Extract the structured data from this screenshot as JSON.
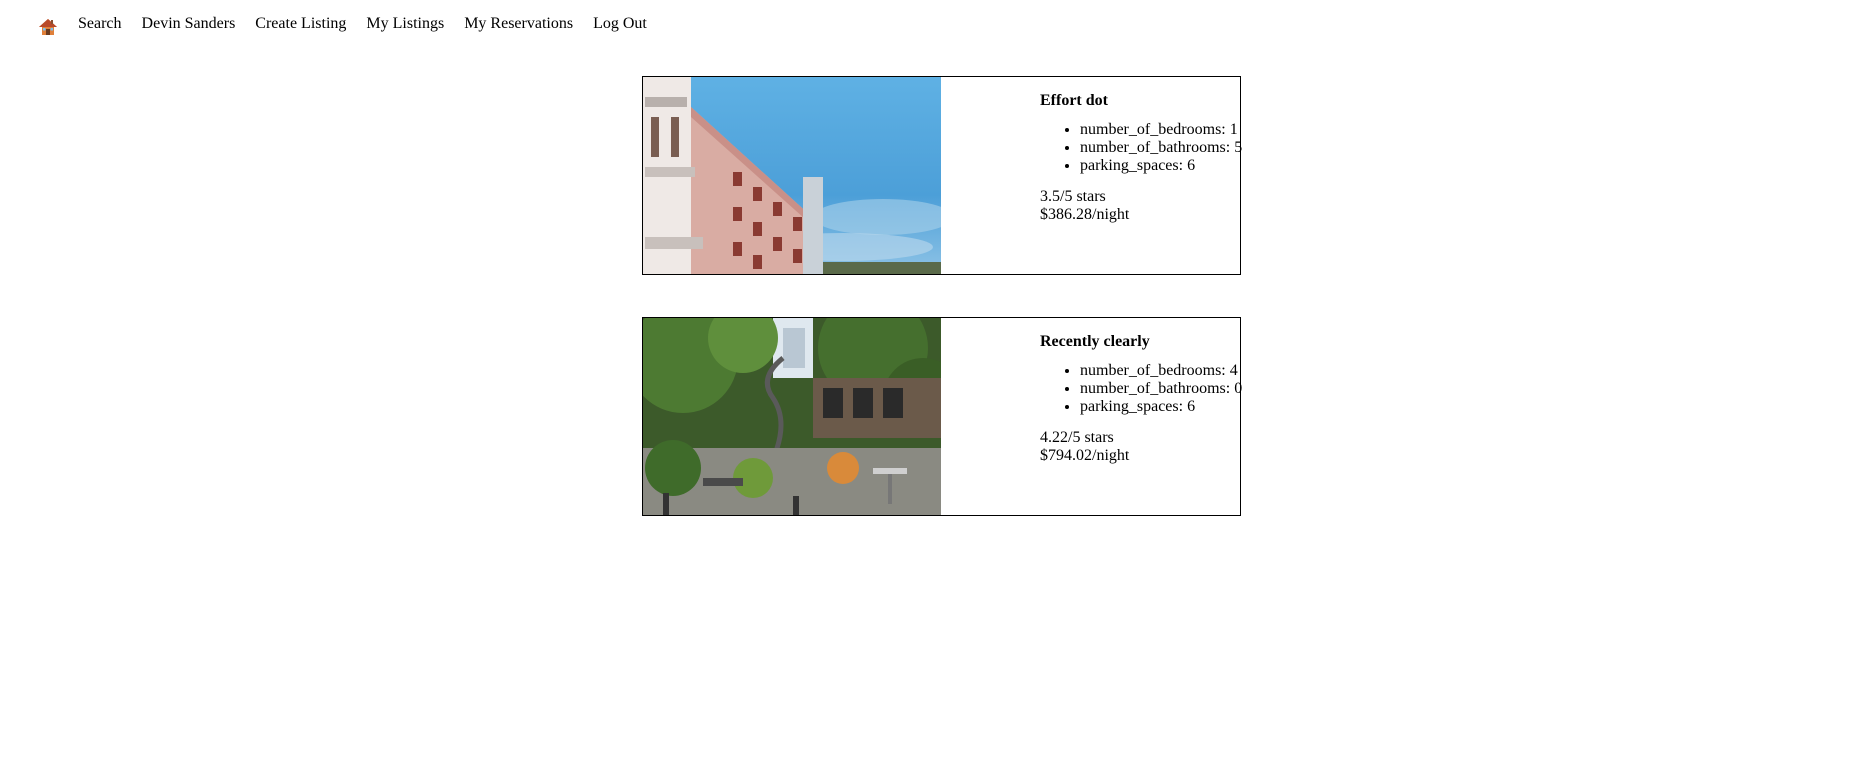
{
  "nav": {
    "home_icon": "house-icon",
    "links": [
      "Search",
      "Devin Sanders",
      "Create Listing",
      "My Listings",
      "My Reservations",
      "Log Out"
    ]
  },
  "listings": [
    {
      "image": "building-facade-photo",
      "title": "Effort dot",
      "features": [
        "number_of_bedrooms: 1",
        "number_of_bathrooms: 5",
        "parking_spaces: 6"
      ],
      "rating": "3.5/5 stars",
      "price": "$386.28/night"
    },
    {
      "image": "garden-courtyard-photo",
      "title": "Recently clearly",
      "features": [
        "number_of_bedrooms: 4",
        "number_of_bathrooms: 0",
        "parking_spaces: 6"
      ],
      "rating": "4.22/5 stars",
      "price": "$794.02/night"
    }
  ],
  "colors": {
    "sky": "#4aa3dc",
    "building": "#d8a79e",
    "foliage": "#3f6b2a"
  }
}
